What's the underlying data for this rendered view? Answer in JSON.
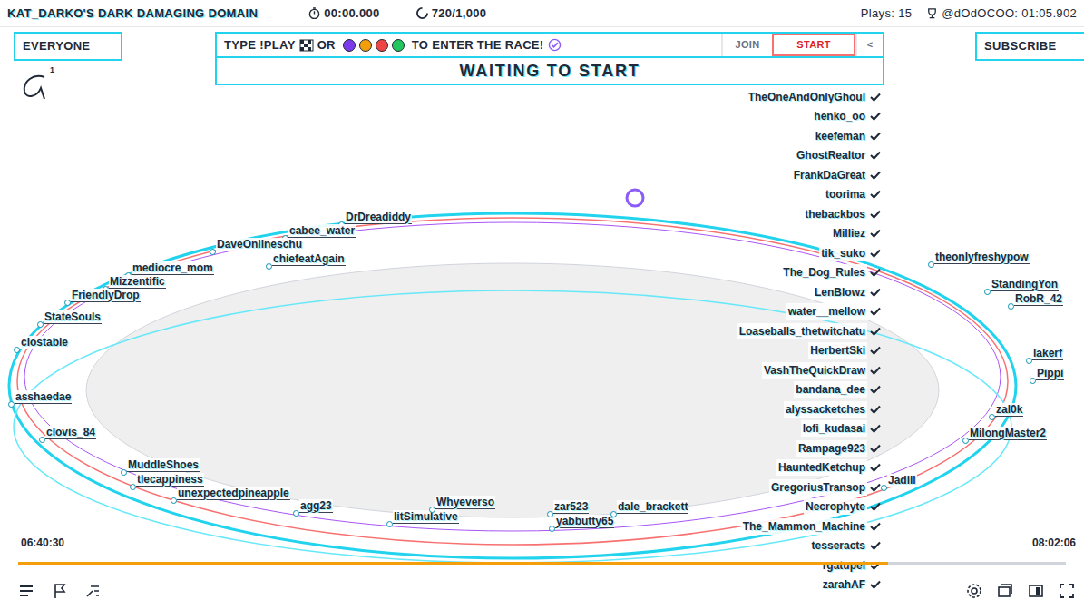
{
  "header": {
    "title": "KAT_DARKO'S DARK DAMAGING DOMAIN",
    "timer": "00:00.000",
    "marbles": "720/1,000",
    "plays": "Plays: 15",
    "record": "@dOdOCOO: 01:05.902"
  },
  "race": {
    "left_tab": "EVERYONE",
    "marker": "1",
    "prompt_start": "TYPE !PLAY",
    "prompt_mid": "OR",
    "prompt_end": "TO ENTER THE RACE!",
    "buttons": [
      {
        "label": "JOIN",
        "selected": false
      },
      {
        "label": "START",
        "selected": true
      },
      {
        "label": "<",
        "selected": false
      }
    ],
    "right_tab": "SUBSCRIBE",
    "status": "WAITING TO START"
  },
  "roster": [
    "TheOneAndOnlyGhoul",
    "henko_oo",
    "keefeman",
    "GhostRealtor",
    "FrankDaGreat",
    "toorima",
    "thebackbos",
    "Milliez",
    "tik_suko",
    "The_Dog_Rules",
    "LenBlowz",
    "water__mellow",
    "Loaseballs_thetwitchatu",
    "HerbertSki",
    "VashTheQuickDraw",
    "bandana_dee",
    "alyssacketches",
    "lofi_kudasai",
    "Rampage923",
    "HauntedKetchup",
    "GregoriusTransop",
    "Necrophyte",
    "The_Mammon_Machine",
    "tesseracts",
    "rgatupel",
    "zarahAF"
  ],
  "track_names": [
    "DrDreadiddy",
    "cabee_water",
    "DaveOnlineschu",
    "chiefeatAgain",
    "mediocre_mom",
    "Mizzentific",
    "FriendlyDrop",
    "StateSouls",
    "clostable",
    "asshaedae",
    "clovis_84",
    "MuddleShoes",
    "tlecappiness",
    "unexpectedpineapple",
    "agg23",
    "litSimulative",
    "Whyeverso",
    "zar523",
    "yabbutty65",
    "dale_brackett",
    "Jadill",
    "MilongMaster2",
    "zal0k",
    "Pippi",
    "lakerf",
    "RobR_42",
    "StandingYon",
    "theonlyfreshypow"
  ],
  "player": {
    "time_current": "06:40:30",
    "time_total": "08:02:06",
    "level": 0.83
  }
}
